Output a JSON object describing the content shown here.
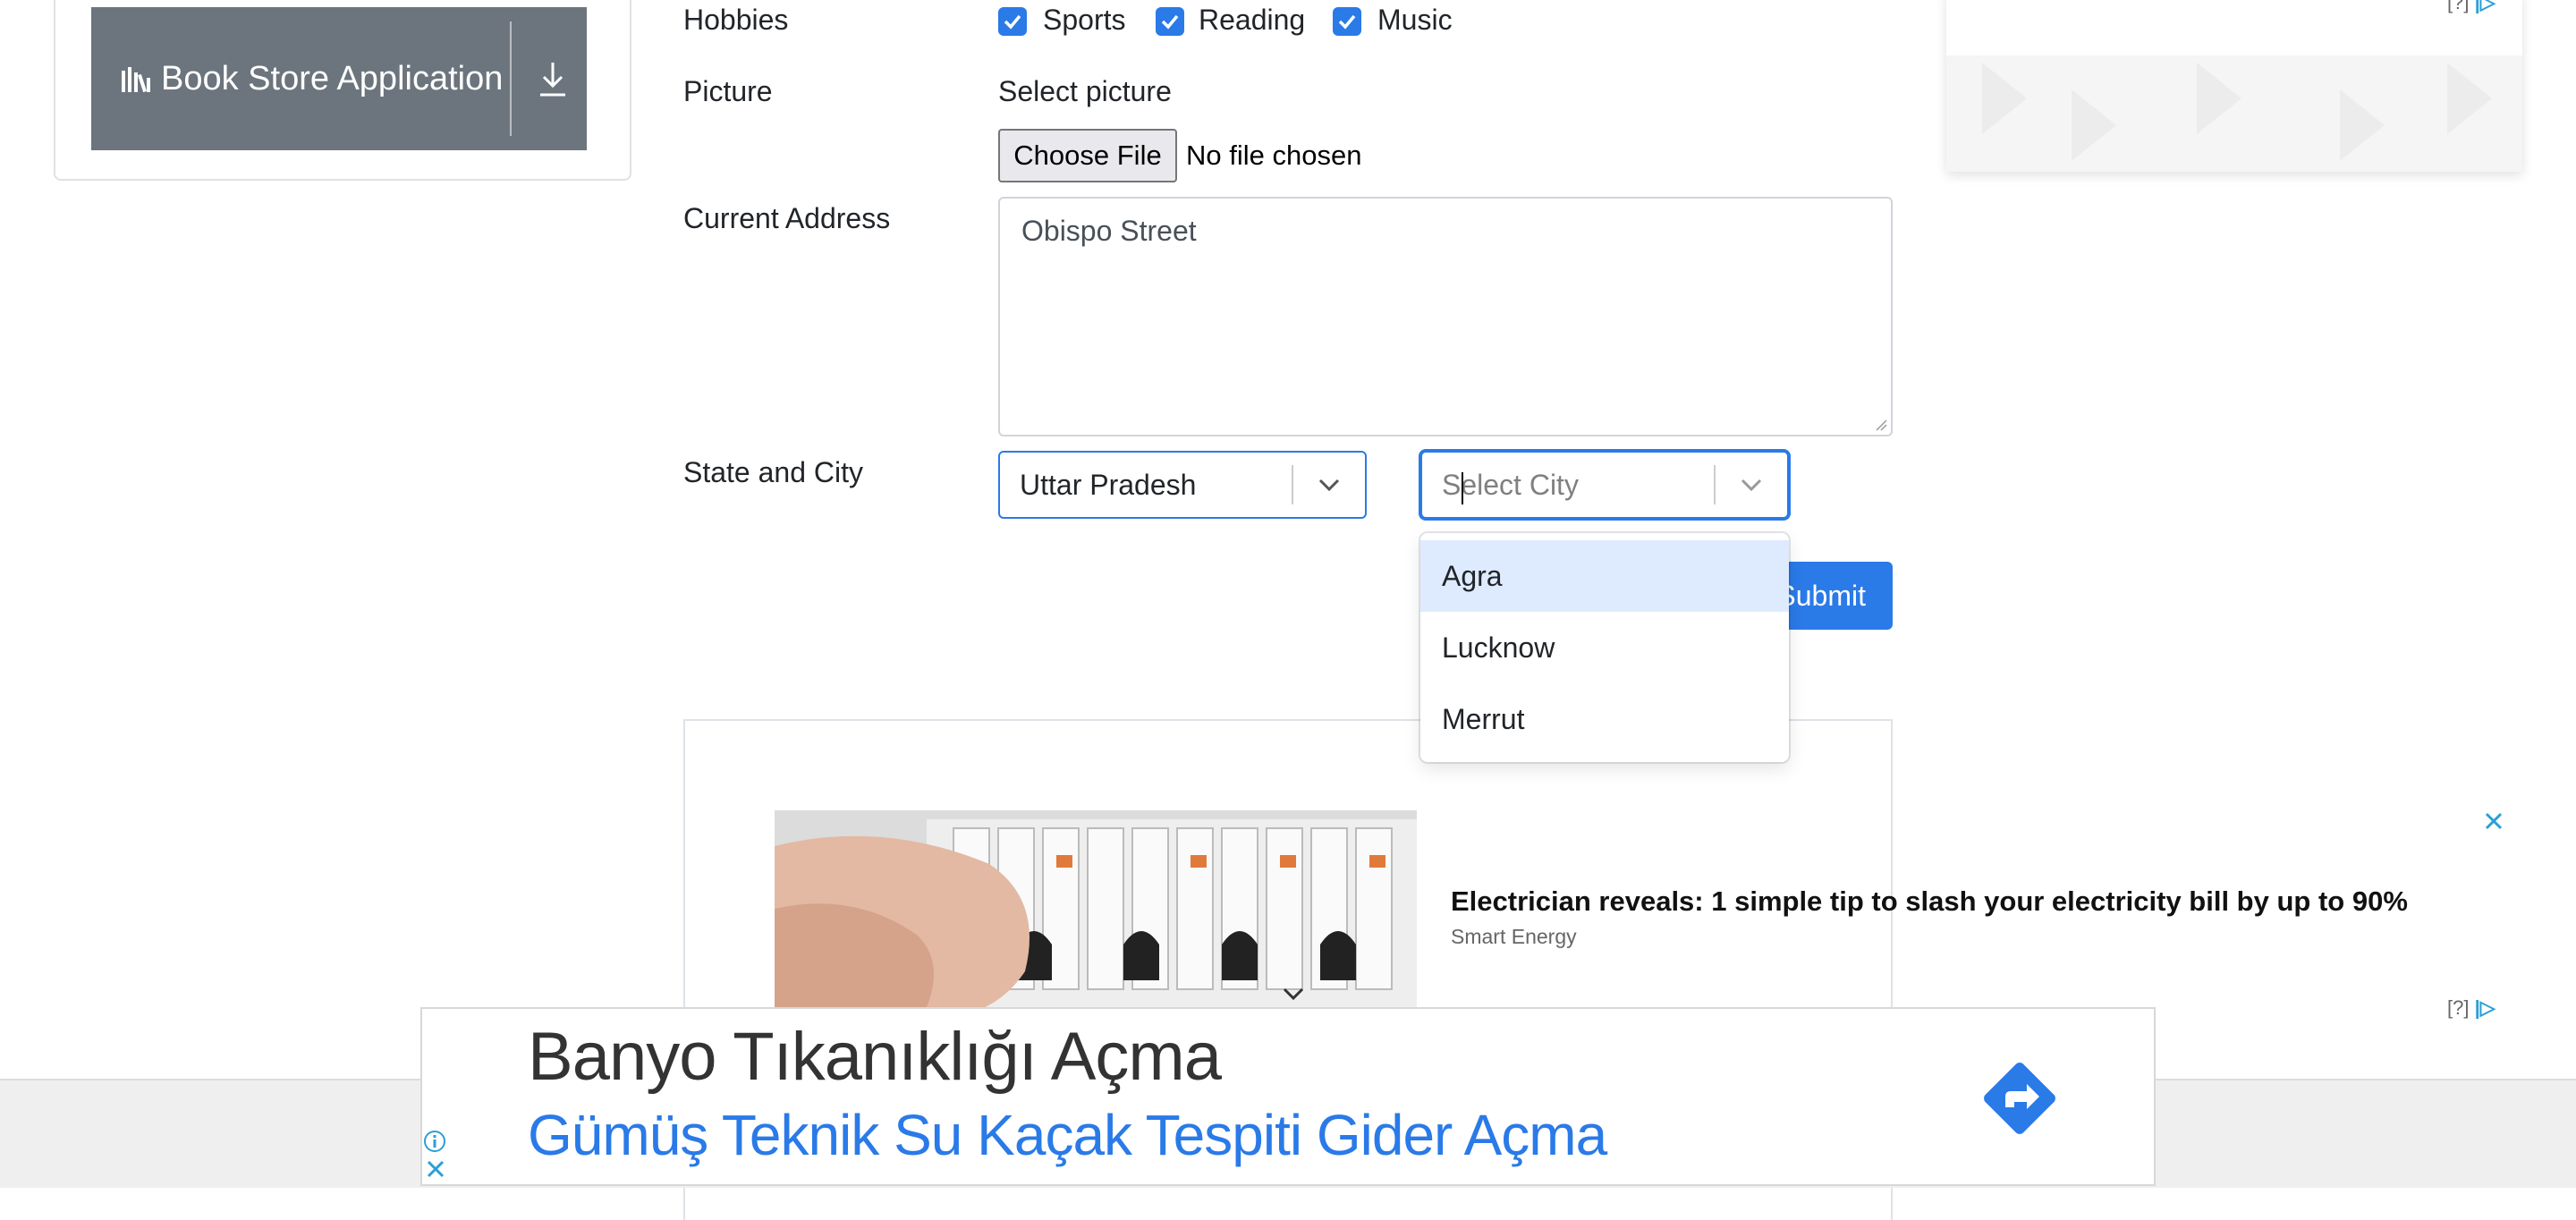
{
  "sidebar": {
    "book_store_label": "Book Store Application"
  },
  "form": {
    "hobbies_label": "Hobbies",
    "hobbies": [
      {
        "label": "Sports",
        "checked": true
      },
      {
        "label": "Reading",
        "checked": true
      },
      {
        "label": "Music",
        "checked": true
      }
    ],
    "picture_label": "Picture",
    "select_picture": "Select picture",
    "choose_file_label": "Choose File",
    "no_file_text": "No file chosen",
    "current_address_label": "Current Address",
    "current_address_value": "Obispo Street",
    "state_city_label": "State and City",
    "state_value": "Uttar Pradesh",
    "city_placeholder": "Select City",
    "city_options": [
      "Agra",
      "Lucknow",
      "Merrut"
    ],
    "city_highlighted": "Agra",
    "submit_label": "Submit"
  },
  "ads": {
    "adchoices_text": "[?]",
    "native_title": "Electrician reveals: 1 simple tip to slash your electricity bill by up to 90%",
    "native_brand": "Smart Energy",
    "banner_title": "Banyo Tıkanıklığı Açma",
    "banner_subtitle": "Gümüş Teknik Su Kaçak Tespiti Gider Açma"
  },
  "colors": {
    "primary": "#2a7ae8",
    "secondary_button": "#6c757d",
    "option_highlight": "#deebff"
  }
}
